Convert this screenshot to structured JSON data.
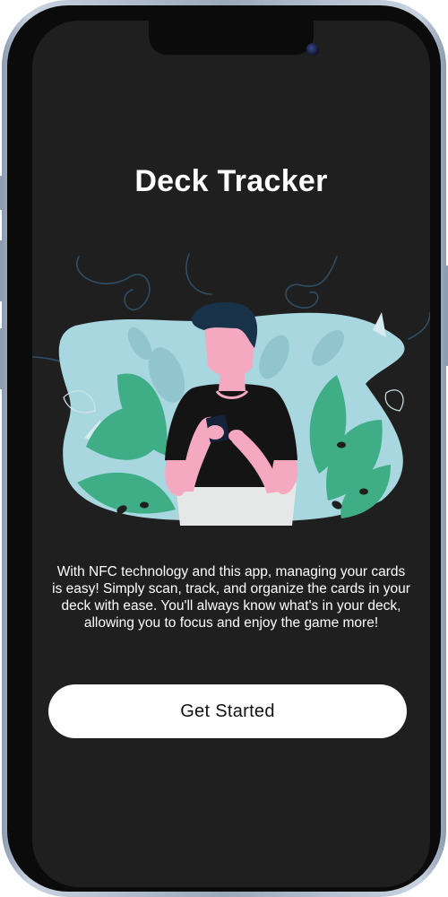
{
  "app": {
    "title": "Deck Tracker"
  },
  "onboarding": {
    "description": "With NFC technology and this app, managing your cards is easy! Simply scan, track, and organize the cards in your deck with ease. You'll always know what's in your deck, allowing you to focus and enjoy the game more!",
    "cta_label": "Get Started",
    "illustration": "person-holding-card-illustration"
  },
  "colors": {
    "screen_background": "#1f1f1f",
    "blob": "#a9d7e0",
    "leaf_green": "#3fae87",
    "leaf_light": "#9fc9c8",
    "skin": "#f5a9c0",
    "hair": "#18324a",
    "button_background": "#ffffff",
    "text": "#ffffff"
  }
}
